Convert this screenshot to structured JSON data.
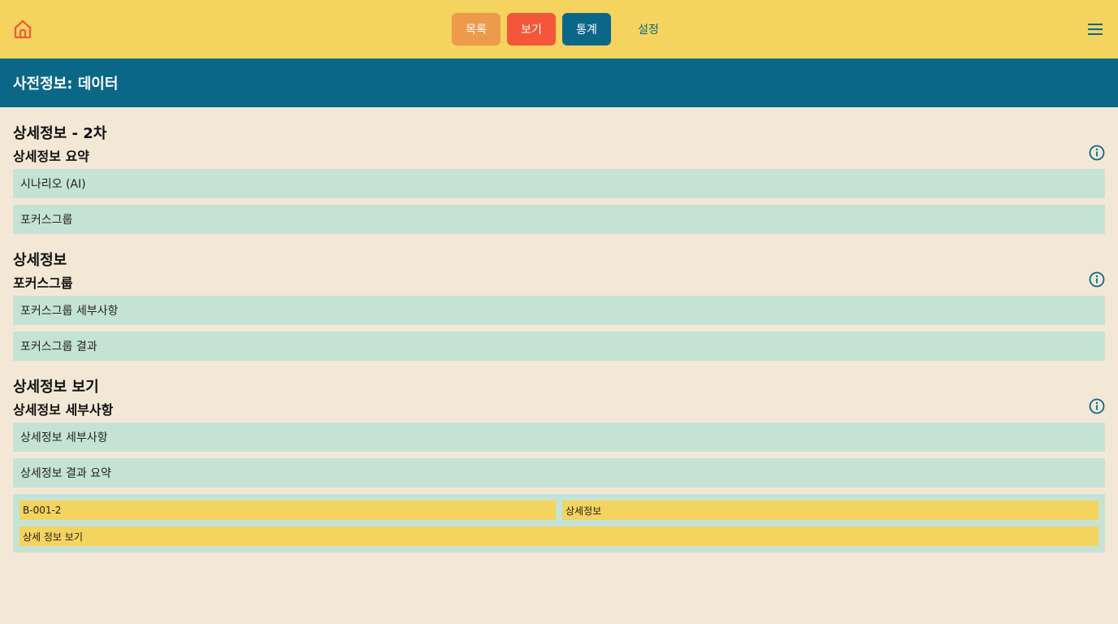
{
  "header": {
    "home_icon": "home-icon",
    "menu_icon": "hamburger-menu-icon",
    "nav": [
      {
        "label": "목록",
        "color": "#ee9a4d"
      },
      {
        "label": "보기",
        "color": "#f4563b"
      },
      {
        "label": "통계",
        "color": "#0b6788"
      },
      {
        "label": "설정",
        "color": "transparent"
      }
    ]
  },
  "page_title": "사전정보: 데이터",
  "sections": [
    {
      "title": "상세정보 - 2차",
      "subtitle": "상세정보 요약",
      "rows": [
        "시나리오 (AI)",
        "포커스그룹"
      ]
    },
    {
      "title": "상세정보",
      "subtitle": "포커스그룹",
      "rows": [
        "포커스그룹 세부사항",
        "포커스그룹 결과"
      ]
    },
    {
      "title": "상세정보 보기",
      "subtitle": "상세정보 세부사항",
      "rows": [
        "상세정보 세부사항",
        "상세정보 결과 요약"
      ]
    }
  ],
  "meta": {
    "id": "B-001-2",
    "type": "상세정보",
    "action": "상세 정보 보기"
  },
  "colors": {
    "topbar": "#f4d35e",
    "titlebar": "#0b6788",
    "background": "#f3e8d5",
    "row": "#c5e3d5",
    "chip": "#f4d35e",
    "icon": "#0b6788",
    "home_icon": "#f4563b"
  }
}
